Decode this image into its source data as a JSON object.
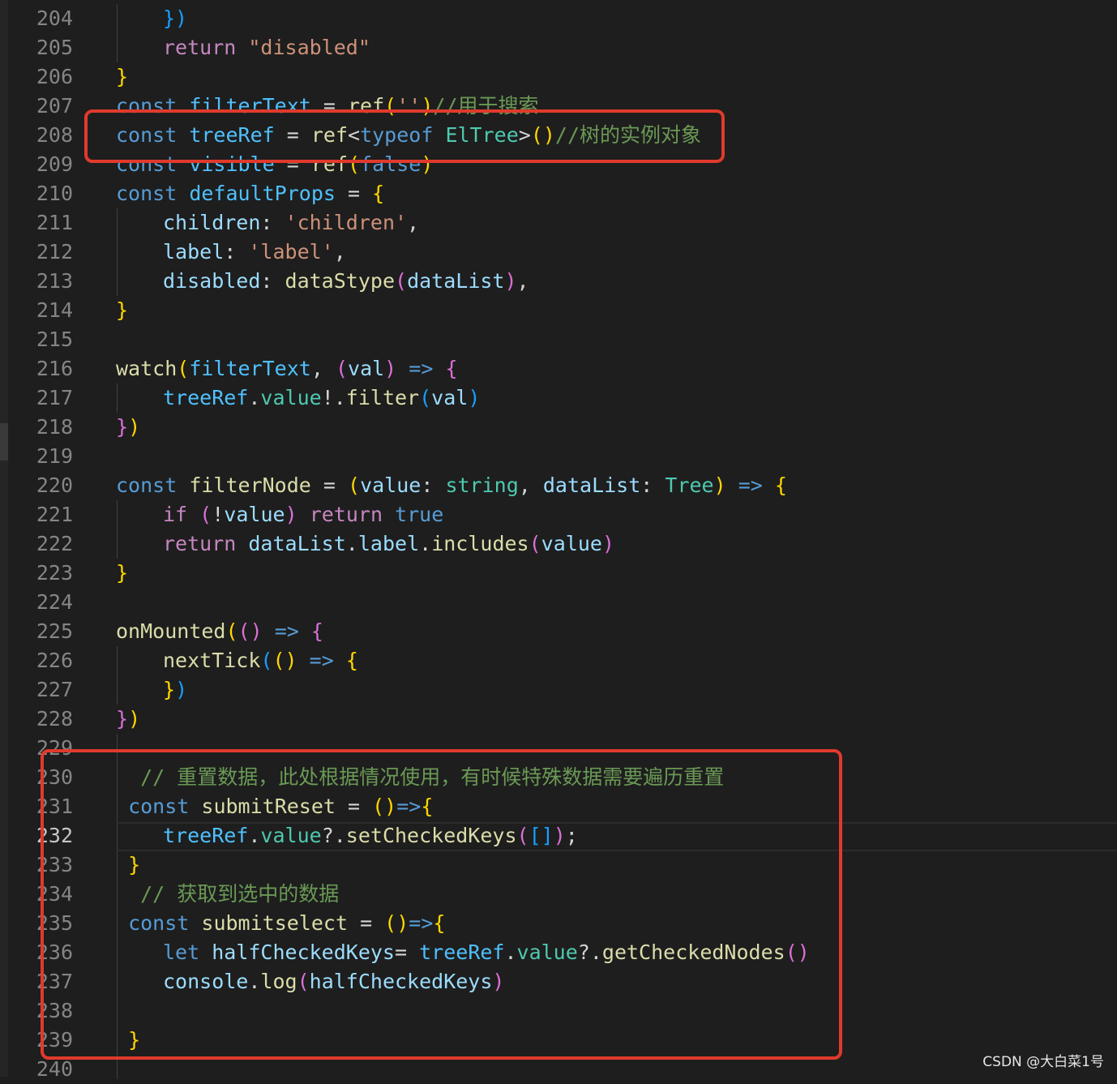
{
  "colors": {
    "background": "#1e1e1e",
    "line_number": "#858585",
    "keyword": "#569cd6",
    "control": "#c586c0",
    "function": "#dcdcaa",
    "variable": "#9cdcfe",
    "constant": "#4fc1ff",
    "type": "#4ec9b0",
    "string": "#ce9178",
    "comment": "#6a9955",
    "bracket_gold": "#ffd700",
    "bracket_purple": "#da70d6",
    "bracket_blue": "#179fff",
    "highlight_box": "#e03a2c"
  },
  "editor": {
    "current_line": "232",
    "lines": [
      {
        "n": "204",
        "i": 2,
        "t": [
          [
            "})",
            "#179fff"
          ]
        ]
      },
      {
        "n": "205",
        "i": 2,
        "t": [
          [
            "return",
            "#c586c0"
          ],
          [
            " ",
            "#d4d4d4"
          ],
          [
            "\"disabled\"",
            "#ce9178"
          ]
        ]
      },
      {
        "n": "206",
        "i": 1,
        "t": [
          [
            "}",
            "#ffd700"
          ]
        ]
      },
      {
        "n": "207",
        "i": 1,
        "t": [
          [
            "const",
            "#569cd6"
          ],
          [
            " ",
            "#d4d4d4"
          ],
          [
            "filterText",
            "#4fc1ff"
          ],
          [
            " = ",
            "#d4d4d4"
          ],
          [
            "ref",
            "#dcdcaa"
          ],
          [
            "(",
            "#ffd700"
          ],
          [
            "''",
            "#ce9178"
          ],
          [
            ")",
            "#ffd700"
          ],
          [
            "//用于搜索",
            "#6a9955"
          ]
        ]
      },
      {
        "n": "208",
        "i": 1,
        "t": [
          [
            "const",
            "#569cd6"
          ],
          [
            " ",
            "#d4d4d4"
          ],
          [
            "treeRef",
            "#4fc1ff"
          ],
          [
            " = ",
            "#d4d4d4"
          ],
          [
            "ref",
            "#dcdcaa"
          ],
          [
            "<",
            "#d4d4d4"
          ],
          [
            "typeof",
            "#569cd6"
          ],
          [
            " ",
            "#d4d4d4"
          ],
          [
            "ElTree",
            "#4ec9b0"
          ],
          [
            ">",
            "#d4d4d4"
          ],
          [
            "()",
            "#ffd700"
          ],
          [
            "//树的实例对象",
            "#6a9955"
          ]
        ]
      },
      {
        "n": "209",
        "i": 1,
        "t": [
          [
            "const",
            "#569cd6"
          ],
          [
            " ",
            "#d4d4d4"
          ],
          [
            "visible",
            "#4fc1ff"
          ],
          [
            " = ",
            "#d4d4d4"
          ],
          [
            "ref",
            "#dcdcaa"
          ],
          [
            "(",
            "#ffd700"
          ],
          [
            "false",
            "#569cd6"
          ],
          [
            ")",
            "#ffd700"
          ]
        ]
      },
      {
        "n": "210",
        "i": 1,
        "t": [
          [
            "const",
            "#569cd6"
          ],
          [
            " ",
            "#d4d4d4"
          ],
          [
            "defaultProps",
            "#4fc1ff"
          ],
          [
            " = ",
            "#d4d4d4"
          ],
          [
            "{",
            "#ffd700"
          ]
        ]
      },
      {
        "n": "211",
        "i": 2,
        "t": [
          [
            "children",
            "#9cdcfe"
          ],
          [
            ": ",
            "#d4d4d4"
          ],
          [
            "'children'",
            "#ce9178"
          ],
          [
            ",",
            "#d4d4d4"
          ]
        ]
      },
      {
        "n": "212",
        "i": 2,
        "t": [
          [
            "label",
            "#9cdcfe"
          ],
          [
            ": ",
            "#d4d4d4"
          ],
          [
            "'label'",
            "#ce9178"
          ],
          [
            ",",
            "#d4d4d4"
          ]
        ]
      },
      {
        "n": "213",
        "i": 2,
        "t": [
          [
            "disabled",
            "#9cdcfe"
          ],
          [
            ": ",
            "#d4d4d4"
          ],
          [
            "dataStype",
            "#dcdcaa"
          ],
          [
            "(",
            "#da70d6"
          ],
          [
            "dataList",
            "#9cdcfe"
          ],
          [
            ")",
            "#da70d6"
          ],
          [
            ",",
            "#d4d4d4"
          ]
        ]
      },
      {
        "n": "214",
        "i": 1,
        "t": [
          [
            "}",
            "#ffd700"
          ]
        ]
      },
      {
        "n": "215",
        "i": 1,
        "t": []
      },
      {
        "n": "216",
        "i": 1,
        "t": [
          [
            "watch",
            "#dcdcaa"
          ],
          [
            "(",
            "#ffd700"
          ],
          [
            "filterText",
            "#4fc1ff"
          ],
          [
            ", ",
            "#d4d4d4"
          ],
          [
            "(",
            "#da70d6"
          ],
          [
            "val",
            "#9cdcfe"
          ],
          [
            ")",
            "#da70d6"
          ],
          [
            " ",
            "#d4d4d4"
          ],
          [
            "=>",
            "#569cd6"
          ],
          [
            " ",
            "#d4d4d4"
          ],
          [
            "{",
            "#da70d6"
          ]
        ]
      },
      {
        "n": "217",
        "i": 2,
        "t": [
          [
            "treeRef",
            "#4fc1ff"
          ],
          [
            ".",
            "#d4d4d4"
          ],
          [
            "value",
            "#4ec9b0"
          ],
          [
            "!.",
            "#d4d4d4"
          ],
          [
            "filter",
            "#dcdcaa"
          ],
          [
            "(",
            "#179fff"
          ],
          [
            "val",
            "#9cdcfe"
          ],
          [
            ")",
            "#179fff"
          ]
        ]
      },
      {
        "n": "218",
        "i": 1,
        "t": [
          [
            "}",
            "#da70d6"
          ],
          [
            ")",
            "#ffd700"
          ]
        ]
      },
      {
        "n": "219",
        "i": 1,
        "t": []
      },
      {
        "n": "220",
        "i": 1,
        "t": [
          [
            "const",
            "#569cd6"
          ],
          [
            " ",
            "#d4d4d4"
          ],
          [
            "filterNode",
            "#dcdcaa"
          ],
          [
            " = ",
            "#d4d4d4"
          ],
          [
            "(",
            "#ffd700"
          ],
          [
            "value",
            "#9cdcfe"
          ],
          [
            ": ",
            "#d4d4d4"
          ],
          [
            "string",
            "#4ec9b0"
          ],
          [
            ", ",
            "#d4d4d4"
          ],
          [
            "dataList",
            "#9cdcfe"
          ],
          [
            ": ",
            "#d4d4d4"
          ],
          [
            "Tree",
            "#4ec9b0"
          ],
          [
            ")",
            "#ffd700"
          ],
          [
            " ",
            "#d4d4d4"
          ],
          [
            "=>",
            "#569cd6"
          ],
          [
            " ",
            "#d4d4d4"
          ],
          [
            "{",
            "#ffd700"
          ]
        ]
      },
      {
        "n": "221",
        "i": 2,
        "t": [
          [
            "if",
            "#c586c0"
          ],
          [
            " ",
            "#d4d4d4"
          ],
          [
            "(",
            "#da70d6"
          ],
          [
            "!",
            "#d4d4d4"
          ],
          [
            "value",
            "#9cdcfe"
          ],
          [
            ")",
            "#da70d6"
          ],
          [
            " ",
            "#d4d4d4"
          ],
          [
            "return",
            "#c586c0"
          ],
          [
            " ",
            "#d4d4d4"
          ],
          [
            "true",
            "#569cd6"
          ]
        ]
      },
      {
        "n": "222",
        "i": 2,
        "t": [
          [
            "return",
            "#c586c0"
          ],
          [
            " ",
            "#d4d4d4"
          ],
          [
            "dataList",
            "#9cdcfe"
          ],
          [
            ".",
            "#d4d4d4"
          ],
          [
            "label",
            "#9cdcfe"
          ],
          [
            ".",
            "#d4d4d4"
          ],
          [
            "includes",
            "#dcdcaa"
          ],
          [
            "(",
            "#da70d6"
          ],
          [
            "value",
            "#9cdcfe"
          ],
          [
            ")",
            "#da70d6"
          ]
        ]
      },
      {
        "n": "223",
        "i": 1,
        "t": [
          [
            "}",
            "#ffd700"
          ]
        ]
      },
      {
        "n": "224",
        "i": 1,
        "t": []
      },
      {
        "n": "225",
        "i": 1,
        "t": [
          [
            "onMounted",
            "#dcdcaa"
          ],
          [
            "(",
            "#ffd700"
          ],
          [
            "()",
            "#da70d6"
          ],
          [
            " ",
            "#d4d4d4"
          ],
          [
            "=>",
            "#569cd6"
          ],
          [
            " ",
            "#d4d4d4"
          ],
          [
            "{",
            "#da70d6"
          ]
        ]
      },
      {
        "n": "226",
        "i": 2,
        "t": [
          [
            "nextTick",
            "#dcdcaa"
          ],
          [
            "(",
            "#179fff"
          ],
          [
            "()",
            "#ffd700"
          ],
          [
            " ",
            "#d4d4d4"
          ],
          [
            "=>",
            "#569cd6"
          ],
          [
            " ",
            "#d4d4d4"
          ],
          [
            "{",
            "#ffd700"
          ]
        ]
      },
      {
        "n": "227",
        "i": 2,
        "t": [
          [
            "}",
            "#ffd700"
          ],
          [
            ")",
            "#179fff"
          ]
        ]
      },
      {
        "n": "228",
        "i": 1,
        "t": [
          [
            "}",
            "#da70d6"
          ],
          [
            ")",
            "#ffd700"
          ]
        ]
      },
      {
        "n": "229",
        "i": 1,
        "t": []
      },
      {
        "n": "230",
        "i": 1,
        "t": [
          [
            "  // 重置数据，此处根据情况使用，有时候特殊数据需要遍历重置",
            "#6a9955"
          ]
        ]
      },
      {
        "n": "231",
        "i": 1,
        "t": [
          [
            " ",
            "#d4d4d4"
          ],
          [
            "const",
            "#569cd6"
          ],
          [
            " ",
            "#d4d4d4"
          ],
          [
            "submitReset",
            "#dcdcaa"
          ],
          [
            " = ",
            "#d4d4d4"
          ],
          [
            "()",
            "#ffd700"
          ],
          [
            "=>",
            "#569cd6"
          ],
          [
            "{",
            "#ffd700"
          ]
        ]
      },
      {
        "n": "232",
        "i": 2,
        "t": [
          [
            "treeRef",
            "#4fc1ff"
          ],
          [
            ".",
            "#d4d4d4"
          ],
          [
            "value",
            "#4ec9b0"
          ],
          [
            "?.",
            "#d4d4d4"
          ],
          [
            "setCheckedKeys",
            "#dcdcaa"
          ],
          [
            "(",
            "#da70d6"
          ],
          [
            "[]",
            "#179fff"
          ],
          [
            ")",
            "#da70d6"
          ],
          [
            ";",
            "#d4d4d4"
          ]
        ]
      },
      {
        "n": "233",
        "i": 1,
        "t": [
          [
            " ",
            "#d4d4d4"
          ],
          [
            "}",
            "#ffd700"
          ]
        ]
      },
      {
        "n": "234",
        "i": 1,
        "t": [
          [
            "  // 获取到选中的数据",
            "#6a9955"
          ]
        ]
      },
      {
        "n": "235",
        "i": 1,
        "t": [
          [
            " ",
            "#d4d4d4"
          ],
          [
            "const",
            "#569cd6"
          ],
          [
            " ",
            "#d4d4d4"
          ],
          [
            "submitselect",
            "#dcdcaa"
          ],
          [
            " = ",
            "#d4d4d4"
          ],
          [
            "()",
            "#ffd700"
          ],
          [
            "=>",
            "#569cd6"
          ],
          [
            "{",
            "#ffd700"
          ]
        ]
      },
      {
        "n": "236",
        "i": 2,
        "t": [
          [
            "let",
            "#569cd6"
          ],
          [
            " ",
            "#d4d4d4"
          ],
          [
            "halfCheckedKeys",
            "#9cdcfe"
          ],
          [
            "= ",
            "#d4d4d4"
          ],
          [
            "treeRef",
            "#4fc1ff"
          ],
          [
            ".",
            "#d4d4d4"
          ],
          [
            "value",
            "#4ec9b0"
          ],
          [
            "?.",
            "#d4d4d4"
          ],
          [
            "getCheckedNodes",
            "#dcdcaa"
          ],
          [
            "()",
            "#da70d6"
          ]
        ]
      },
      {
        "n": "237",
        "i": 2,
        "t": [
          [
            "console",
            "#9cdcfe"
          ],
          [
            ".",
            "#d4d4d4"
          ],
          [
            "log",
            "#dcdcaa"
          ],
          [
            "(",
            "#da70d6"
          ],
          [
            "halfCheckedKeys",
            "#9cdcfe"
          ],
          [
            ")",
            "#da70d6"
          ]
        ]
      },
      {
        "n": "238",
        "i": 2,
        "t": []
      },
      {
        "n": "239",
        "i": 1,
        "t": [
          [
            " ",
            "#d4d4d4"
          ],
          [
            "}",
            "#ffd700"
          ]
        ]
      },
      {
        "n": "240",
        "i": 1,
        "t": []
      }
    ]
  },
  "watermark": "CSDN @大白菜1号"
}
